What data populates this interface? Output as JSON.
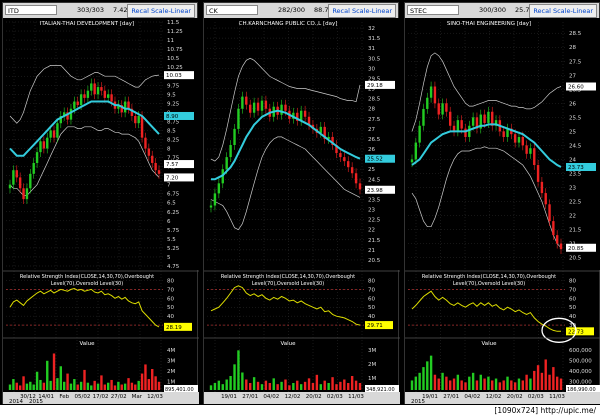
{
  "colors": {
    "up": "#22cc22",
    "down": "#ee2222",
    "ma": "#33ccdd",
    "band": "#cccccc",
    "rsi": "#dddd00",
    "grid": "#3a3a3a",
    "vol": "#dddd00"
  },
  "panels": [
    {
      "symbol": "ITD",
      "counter": "303/303",
      "price": "7.42",
      "button": "Recal Scale-Linear",
      "title": "ITALIAN-THAI DEVELOPMENT [day]",
      "yticks": [
        "11.5",
        "11.25",
        "11",
        "10.75",
        "10.5",
        "10.25",
        "10",
        "9.75",
        "9.5",
        "9.25",
        "9",
        "8.75",
        "8.5",
        "8.25",
        "8",
        "7.75",
        "7.5",
        "7.25",
        "7",
        "6.75",
        "6.5",
        "6.25",
        "6",
        "5.75",
        "5.5",
        "5.25",
        "5",
        "4.75"
      ],
      "ylim": [
        4.75,
        11.5
      ],
      "price_tags": [
        {
          "label": "10.03",
          "value": 10.03,
          "color": "#ffffff"
        },
        {
          "label": "8.90",
          "value": 8.9,
          "color": "#33ccdd"
        },
        {
          "label": "7.57",
          "value": 7.57,
          "color": "#ffffff"
        },
        {
          "label": "7.20",
          "value": 7.2,
          "color": "#ffffff"
        }
      ],
      "closes": [
        7.0,
        7.4,
        7.2,
        6.9,
        6.6,
        6.9,
        7.3,
        7.6,
        7.9,
        8.2,
        8.0,
        8.3,
        8.5,
        8.3,
        8.7,
        8.9,
        9.0,
        8.8,
        9.1,
        9.3,
        9.2,
        9.5,
        9.4,
        9.6,
        9.8,
        9.5,
        9.7,
        9.6,
        9.4,
        9.5,
        9.3,
        9.1,
        9.2,
        9.0,
        9.3,
        9.1,
        8.9,
        8.7,
        8.9,
        8.3,
        8.0,
        7.8,
        7.6,
        7.4,
        7.3
      ],
      "ma": [
        8.0,
        7.9,
        7.8,
        7.8,
        7.8,
        7.9,
        8.0,
        8.1,
        8.2,
        8.3,
        8.4,
        8.5,
        8.6,
        8.7,
        8.8,
        8.85,
        8.9,
        8.95,
        9.0,
        9.05,
        9.1,
        9.15,
        9.2,
        9.25,
        9.3,
        9.3,
        9.3,
        9.3,
        9.3,
        9.3,
        9.25,
        9.2,
        9.2,
        9.15,
        9.1,
        9.1,
        9.05,
        9.0,
        8.95,
        8.9,
        8.8,
        8.7,
        8.6,
        8.5,
        8.4
      ],
      "upper": [
        8.9,
        8.8,
        8.7,
        8.8,
        9.0,
        9.3,
        9.6,
        9.8,
        10.0,
        10.1,
        10.2,
        10.25,
        10.3,
        10.3,
        10.3,
        10.3,
        10.2,
        10.1,
        10.0,
        9.95,
        9.9,
        9.9,
        9.95,
        10.0,
        10.05,
        10.1,
        10.1,
        10.05,
        10.0,
        10.0,
        10.0,
        10.0,
        9.95,
        9.9,
        9.85,
        9.8,
        9.75,
        9.7,
        9.7,
        9.8,
        9.9,
        9.95,
        10.0,
        10.02,
        10.03
      ],
      "lower": [
        7.0,
        6.9,
        6.9,
        6.8,
        6.7,
        6.7,
        6.8,
        6.9,
        7.0,
        7.2,
        7.4,
        7.6,
        7.8,
        8.0,
        8.2,
        8.4,
        8.5,
        8.6,
        8.6,
        8.6,
        8.55,
        8.55,
        8.6,
        8.6,
        8.6,
        8.55,
        8.5,
        8.5,
        8.55,
        8.55,
        8.5,
        8.45,
        8.45,
        8.4,
        8.4,
        8.4,
        8.35,
        8.3,
        8.2,
        8.0,
        7.8,
        7.6,
        7.4,
        7.3,
        7.2
      ],
      "rsi_title": "Relative Strength Index(CLOSE,14,30,70),Overbought Level(70),Oversold Level(30)",
      "rsi_yticks": [
        "80",
        "70",
        "60",
        "50",
        "40",
        "30"
      ],
      "rsi_tag": "28.19",
      "rsi": [
        50,
        56,
        58,
        55,
        52,
        57,
        60,
        63,
        66,
        68,
        65,
        67,
        69,
        66,
        68,
        70,
        69,
        68,
        70,
        71,
        69,
        70,
        68,
        69,
        70,
        67,
        66,
        68,
        64,
        65,
        63,
        60,
        62,
        59,
        61,
        57,
        55,
        54,
        56,
        46,
        42,
        38,
        34,
        30,
        28
      ],
      "vol_title": "Value",
      "vol_yticks": [
        "4M",
        "3M",
        "2M",
        "1M"
      ],
      "vol_tag": "895,401.00",
      "volume": [
        0.6,
        1.2,
        0.8,
        0.5,
        1.5,
        0.7,
        0.9,
        0.6,
        2.0,
        1.1,
        0.8,
        3.2,
        1.0,
        4.0,
        1.3,
        2.6,
        0.9,
        1.8,
        0.7,
        1.2,
        0.6,
        0.9,
        2.2,
        0.8,
        0.5,
        1.0,
        0.7,
        1.6,
        0.6,
        0.8,
        1.1,
        0.5,
        0.9,
        0.6,
        0.7,
        1.3,
        0.8,
        0.6,
        1.0,
        1.8,
        2.8,
        1.2,
        2.3,
        1.5,
        0.9
      ],
      "vmax": 4.6,
      "dates": [
        "30/12",
        "14/01",
        "Feb",
        "05/02",
        "17/02",
        "27/02",
        "Mar",
        "12/03"
      ],
      "years": [
        "2014",
        "2015"
      ]
    },
    {
      "symbol": "CK",
      "counter": "282/300",
      "price": "88.70",
      "button": "Recal Scale-Linear",
      "title": "CH.KARNCHANG PUBLIC CO.,L [day]",
      "yticks": [
        "32",
        "31.5",
        "31",
        "30.5",
        "30",
        "29.5",
        "29",
        "28.5",
        "28",
        "27.5",
        "27",
        "26.5",
        "26",
        "25.5",
        "25",
        "24.5",
        "24",
        "23.5",
        "23",
        "22.5",
        "22",
        "21.5",
        "21",
        "20.5"
      ],
      "ylim": [
        20.2,
        32.3
      ],
      "price_tags": [
        {
          "label": "29.18",
          "value": 29.18,
          "color": "#ffffff"
        },
        {
          "label": "25.52",
          "value": 25.52,
          "color": "#33ccdd"
        },
        {
          "label": "23.98",
          "value": 23.98,
          "color": "#ffffff"
        }
      ],
      "closes": [
        23.2,
        23.8,
        24.3,
        25.0,
        25.6,
        26.2,
        27.0,
        28.0,
        28.6,
        28.2,
        27.8,
        28.3,
        27.9,
        28.4,
        28.0,
        27.6,
        28.1,
        27.7,
        28.2,
        27.9,
        27.5,
        27.8,
        27.4,
        27.9,
        27.6,
        27.2,
        27.0,
        26.8,
        27.1,
        26.5,
        26.6,
        26.2,
        25.8,
        25.6,
        25.4,
        25.1,
        24.8,
        24.3,
        24.0
      ],
      "ma": [
        24.5,
        24.5,
        24.6,
        24.7,
        24.9,
        25.1,
        25.4,
        25.8,
        26.2,
        26.6,
        26.9,
        27.2,
        27.4,
        27.6,
        27.7,
        27.8,
        27.85,
        27.9,
        27.85,
        27.8,
        27.7,
        27.6,
        27.5,
        27.4,
        27.3,
        27.2,
        27.05,
        26.9,
        26.75,
        26.6,
        26.45,
        26.3,
        26.15,
        26.0,
        25.9,
        25.8,
        25.7,
        25.6,
        25.52
      ],
      "upper": [
        25.5,
        25.4,
        25.6,
        26.2,
        27.0,
        27.9,
        28.8,
        29.6,
        30.1,
        30.4,
        30.5,
        30.4,
        30.2,
        30.0,
        29.8,
        29.6,
        29.5,
        29.4,
        29.3,
        29.2,
        29.1,
        29.05,
        29.0,
        29.0,
        29.0,
        28.95,
        28.9,
        28.85,
        28.8,
        28.75,
        28.7,
        28.65,
        28.6,
        28.5,
        28.45,
        28.4,
        28.4,
        28.35,
        29.18
      ],
      "lower": [
        23.5,
        23.4,
        23.3,
        23.2,
        22.9,
        22.5,
        22.1,
        22.0,
        22.3,
        22.9,
        23.6,
        24.3,
        25.0,
        25.6,
        26.0,
        26.3,
        26.5,
        26.6,
        26.6,
        26.5,
        26.4,
        26.3,
        26.2,
        26.1,
        26.0,
        25.8,
        25.6,
        25.4,
        25.2,
        25.0,
        24.8,
        24.6,
        24.4,
        24.2,
        24.0,
        23.9,
        23.8,
        23.7,
        23.6
      ],
      "rsi_title": "Relative Strength Index(CLOSE,14,30,70),Overbought Level(70),Oversold Level(30)",
      "rsi_yticks": [
        "80",
        "70",
        "60",
        "50",
        "40",
        "30"
      ],
      "rsi_tag": "29.71",
      "rsi": [
        46,
        48,
        50,
        55,
        60,
        66,
        72,
        74,
        72,
        66,
        63,
        65,
        62,
        64,
        60,
        58,
        61,
        59,
        62,
        60,
        57,
        58,
        55,
        57,
        54,
        52,
        50,
        48,
        50,
        45,
        46,
        42,
        40,
        39,
        38,
        36,
        34,
        31,
        30
      ],
      "vol_title": "Value",
      "vol_yticks": [
        "3M",
        "2M",
        "1M"
      ],
      "vol_tag": "348,921.00",
      "volume": [
        0.4,
        0.6,
        0.8,
        0.5,
        0.9,
        1.2,
        2.2,
        3.4,
        1.5,
        0.9,
        0.6,
        1.1,
        0.7,
        0.5,
        0.8,
        0.6,
        1.0,
        0.5,
        0.7,
        0.9,
        0.4,
        0.6,
        0.8,
        0.5,
        0.7,
        1.0,
        0.6,
        1.3,
        0.5,
        0.8,
        0.6,
        1.1,
        0.5,
        0.7,
        0.9,
        0.6,
        1.2,
        0.8,
        0.6
      ],
      "vmax": 3.6,
      "dates": [
        "19/01",
        "27/01",
        "04/02",
        "12/02",
        "20/02",
        "02/03",
        "11/03"
      ],
      "years": []
    },
    {
      "symbol": "STEC",
      "counter": "300/300",
      "price": "25.77",
      "button": "Recal Scale-Linear",
      "title": "SINO-THAI ENGINEERING [day]",
      "yticks": [
        "28.5",
        "28",
        "27.5",
        "27",
        "26.5",
        "26",
        "25.5",
        "25",
        "24.5",
        "24",
        "23.5",
        "23",
        "22.5",
        "22",
        "21.5",
        "21",
        "20.5"
      ],
      "ylim": [
        20.2,
        28.9
      ],
      "price_tags": [
        {
          "label": "26.60",
          "value": 26.6,
          "color": "#ffffff"
        },
        {
          "label": "23.73",
          "value": 23.73,
          "color": "#33ccdd"
        },
        {
          "label": "20.85",
          "value": 20.85,
          "color": "#ffffff"
        }
      ],
      "closes": [
        24.0,
        24.6,
        25.2,
        25.8,
        26.2,
        26.6,
        26.0,
        25.6,
        26.0,
        25.7,
        25.2,
        25.0,
        25.4,
        25.1,
        24.8,
        25.2,
        25.5,
        25.1,
        25.6,
        25.3,
        25.7,
        25.2,
        25.4,
        25.0,
        24.8,
        25.1,
        24.9,
        24.6,
        24.8,
        24.5,
        24.2,
        24.4,
        23.8,
        23.2,
        22.8,
        22.4,
        21.8,
        21.3,
        21.0,
        20.8
      ],
      "ma": [
        23.8,
        23.9,
        24.0,
        24.2,
        24.4,
        24.6,
        24.7,
        24.8,
        24.9,
        24.95,
        25.0,
        25.0,
        25.0,
        25.0,
        25.0,
        25.05,
        25.1,
        25.15,
        25.2,
        25.2,
        25.25,
        25.25,
        25.25,
        25.2,
        25.15,
        25.1,
        25.05,
        25.0,
        24.95,
        24.9,
        24.8,
        24.7,
        24.6,
        24.45,
        24.3,
        24.15,
        24.0,
        23.9,
        23.8,
        23.73
      ],
      "upper": [
        25.0,
        25.4,
        26.0,
        26.7,
        27.3,
        27.7,
        27.8,
        27.7,
        27.5,
        27.2,
        26.9,
        26.6,
        26.4,
        26.2,
        26.0,
        25.9,
        25.9,
        25.95,
        26.0,
        26.05,
        26.1,
        26.1,
        26.1,
        26.05,
        26.0,
        25.95,
        25.9,
        25.9,
        25.85,
        25.85,
        25.8,
        25.8,
        25.85,
        25.95,
        26.05,
        26.2,
        26.35,
        26.45,
        26.55,
        26.6
      ],
      "lower": [
        22.8,
        22.6,
        22.2,
        21.8,
        21.6,
        21.6,
        21.9,
        22.3,
        22.8,
        23.3,
        23.7,
        24.0,
        24.2,
        24.3,
        24.3,
        24.3,
        24.35,
        24.4,
        24.4,
        24.45,
        24.4,
        24.4,
        24.4,
        24.35,
        24.3,
        24.2,
        24.1,
        24.0,
        23.9,
        23.8,
        23.6,
        23.4,
        23.1,
        22.8,
        22.5,
        22.1,
        21.7,
        21.3,
        21.0,
        20.85
      ],
      "rsi_title": "Relative Strength Index(CLOSE,14,30,70),Overbought Level(70),Oversold Level(30)",
      "rsi_yticks": [
        "80",
        "70",
        "60",
        "50",
        "40",
        "30"
      ],
      "rsi_tag": "22.73",
      "rsi": [
        48,
        52,
        57,
        62,
        65,
        68,
        62,
        58,
        61,
        58,
        54,
        52,
        55,
        52,
        50,
        53,
        55,
        51,
        55,
        52,
        55,
        51,
        53,
        49,
        47,
        50,
        48,
        45,
        47,
        44,
        42,
        44,
        38,
        34,
        31,
        29,
        26,
        24,
        23,
        23
      ],
      "vol_title": "Value",
      "vol_yticks": [
        "600,000",
        "500,000",
        "400,000",
        "300,000"
      ],
      "vol_tag": "186,990.00",
      "volume": [
        0.5,
        0.7,
        0.9,
        1.2,
        1.5,
        1.8,
        0.8,
        0.6,
        0.9,
        0.7,
        0.5,
        0.6,
        0.8,
        0.5,
        0.4,
        0.7,
        0.9,
        0.5,
        0.8,
        0.6,
        0.7,
        0.5,
        0.6,
        0.4,
        0.5,
        0.7,
        0.5,
        0.4,
        0.6,
        0.5,
        0.8,
        0.6,
        1.0,
        1.3,
        0.9,
        1.6,
        0.8,
        1.2,
        0.7,
        0.6
      ],
      "vmax": 2.2,
      "dates": [
        "19/01",
        "27/01",
        "04/02",
        "12/02",
        "20/02",
        "02/03",
        "11/03"
      ],
      "years": [
        "2015"
      ]
    }
  ],
  "footer": "[1090x724] http://upic.me/",
  "chart_data": [
    {
      "type": "line",
      "title": "ITALIAN-THAI DEVELOPMENT [day]",
      "ylim": [
        4.75,
        11.5
      ],
      "last": 7.42,
      "rsi_last": 28.19,
      "volume_last": "895,401.00"
    },
    {
      "type": "line",
      "title": "CH.KARNCHANG PUBLIC CO.,L [day]",
      "ylim": [
        20.2,
        32.3
      ],
      "last": 88.7,
      "rsi_last": 29.71,
      "volume_last": "348,921.00"
    },
    {
      "type": "line",
      "title": "SINO-THAI ENGINEERING [day]",
      "ylim": [
        20.2,
        28.9
      ],
      "last": 25.77,
      "rsi_last": 22.73,
      "volume_last": "186,990.00"
    }
  ]
}
